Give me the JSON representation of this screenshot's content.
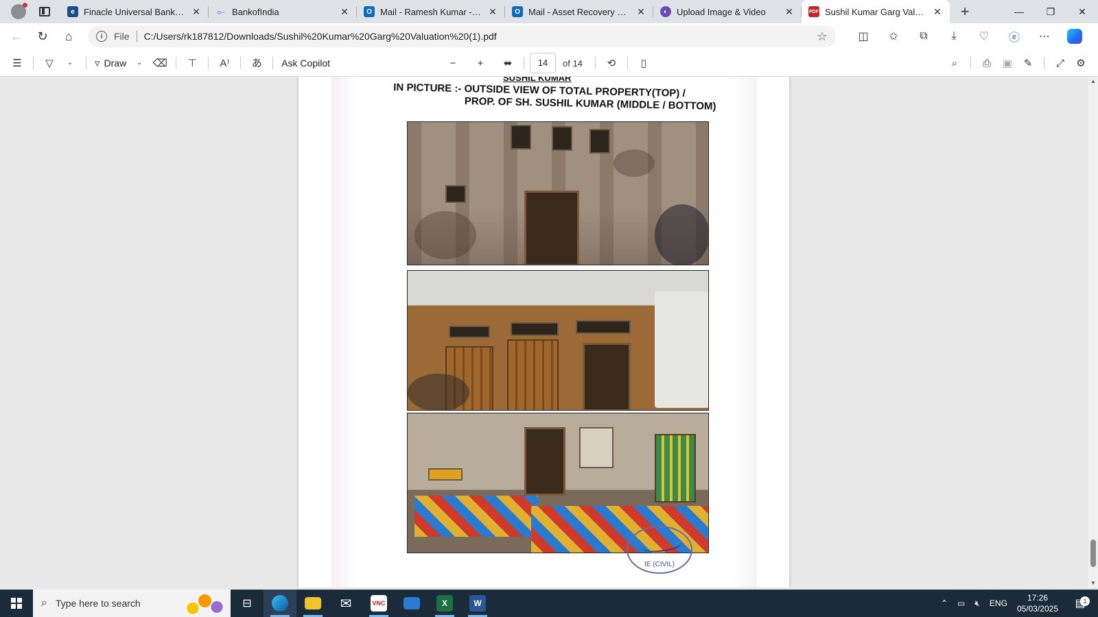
{
  "browser": {
    "tabs": [
      {
        "title": "Finacle Universal Banking Sol",
        "favicon": "ie-icon",
        "color": "#1a4f8a"
      },
      {
        "title": "BankofIndia",
        "favicon": "link-icon",
        "color": "#7aa7d8"
      },
      {
        "title": "Mail - Ramesh Kumar - Outlo",
        "favicon": "outlook-icon",
        "color": "#0f6cbd"
      },
      {
        "title": "Mail - Asset Recovery Depart",
        "favicon": "outlook-icon",
        "color": "#0f6cbd"
      },
      {
        "title": "Upload Image & Video",
        "favicon": "purple-app-icon",
        "color": "#6b4ab8"
      },
      {
        "title": "Sushil Kumar Garg Valuation",
        "favicon": "pdf-icon",
        "color": "#c4262e"
      }
    ],
    "new_tab_symbol": "+",
    "window": {
      "minimize": "—",
      "maximize": "❐",
      "close": "✕"
    }
  },
  "address_bar": {
    "scheme_label": "File",
    "url": "C:/Users/rk187812/Downloads/Sushil%20Kumar%20Garg%20Valuation%20(1).pdf"
  },
  "pdf_toolbar": {
    "draw_label": "Draw",
    "ask_copilot_label": "Ask Copilot",
    "current_page": "14",
    "page_of": "of 14"
  },
  "document": {
    "heading_top": "SUSHIL KUMAR",
    "heading_line1": "IN PICTURE :- OUTSIDE VIEW OF TOTAL PROPERTY(TOP) /",
    "heading_line2": "PROP. OF SH. SUSHIL KUMAR (MIDDLE / BOTTOM)",
    "stamp_text": "IE (CIVIL)"
  },
  "taskbar": {
    "search_placeholder": "Type here to search",
    "language": "ENG",
    "time": "17:26",
    "date": "05/03/2025",
    "notification_count": "1"
  },
  "colors": {
    "accent": "#0f6cbd",
    "taskbar_bg": "#1c2b3a",
    "excel": "#1d7044",
    "word": "#2b5797"
  }
}
